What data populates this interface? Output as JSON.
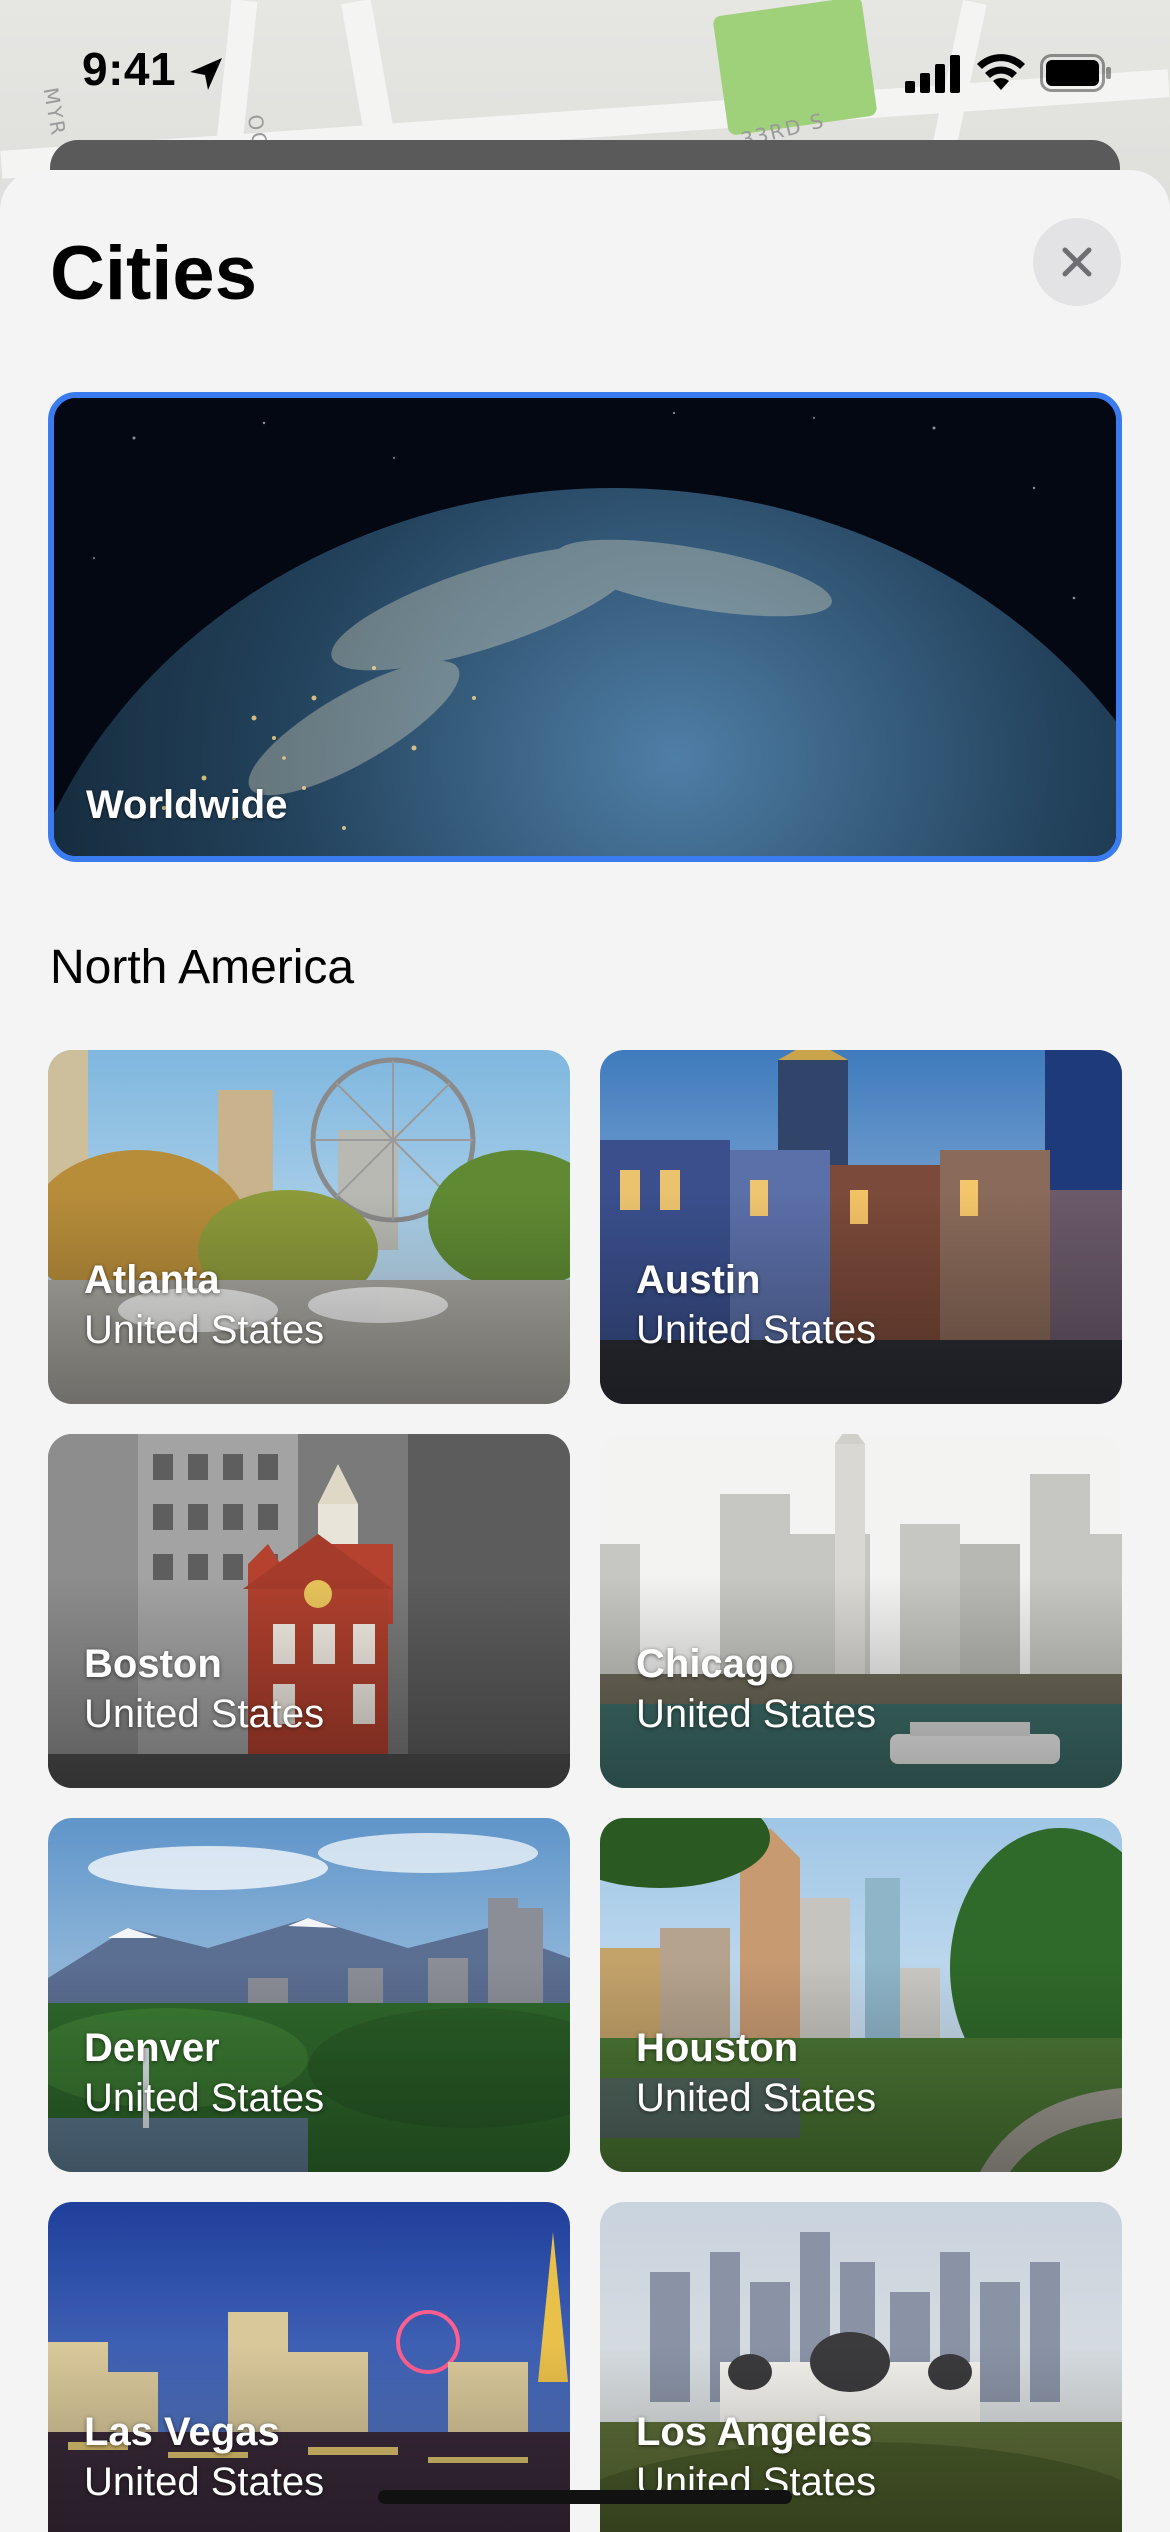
{
  "status_bar": {
    "time": "9:41"
  },
  "sheet": {
    "title": "Cities",
    "close_label": "Close"
  },
  "featured": {
    "label": "Worldwide"
  },
  "section": {
    "title": "North America"
  },
  "cities": [
    {
      "name": "Atlanta",
      "country": "United States"
    },
    {
      "name": "Austin",
      "country": "United States"
    },
    {
      "name": "Boston",
      "country": "United States"
    },
    {
      "name": "Chicago",
      "country": "United States"
    },
    {
      "name": "Denver",
      "country": "United States"
    },
    {
      "name": "Houston",
      "country": "United States"
    },
    {
      "name": "Las Vegas",
      "country": "United States"
    },
    {
      "name": "Los Angeles",
      "country": "United States"
    }
  ],
  "colors": {
    "selection_border": "#3a7bf0",
    "sheet_background": "#f4f4f4",
    "close_button_background": "#e3e3e5"
  }
}
